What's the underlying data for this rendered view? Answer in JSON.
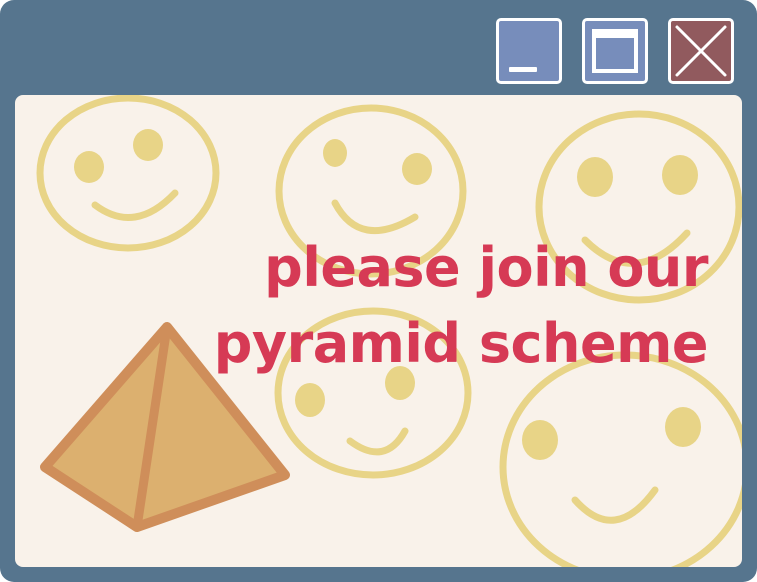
{
  "window": {
    "colors": {
      "frame": "#56758e",
      "content_background": "#f9f2ea",
      "button_blue": "#778dbb",
      "button_close": "#915a5e",
      "text_accent": "#d63a55",
      "smiley": "#e8d487",
      "pyramid_fill": "#dcb06f",
      "pyramid_stroke": "#cf8e5a"
    },
    "controls": {
      "minimize_icon": "minimize-icon",
      "maximize_icon": "maximize-icon",
      "close_icon": "close-icon"
    }
  },
  "content": {
    "message_line1": "please join our",
    "message_line2": "pyramid scheme"
  }
}
